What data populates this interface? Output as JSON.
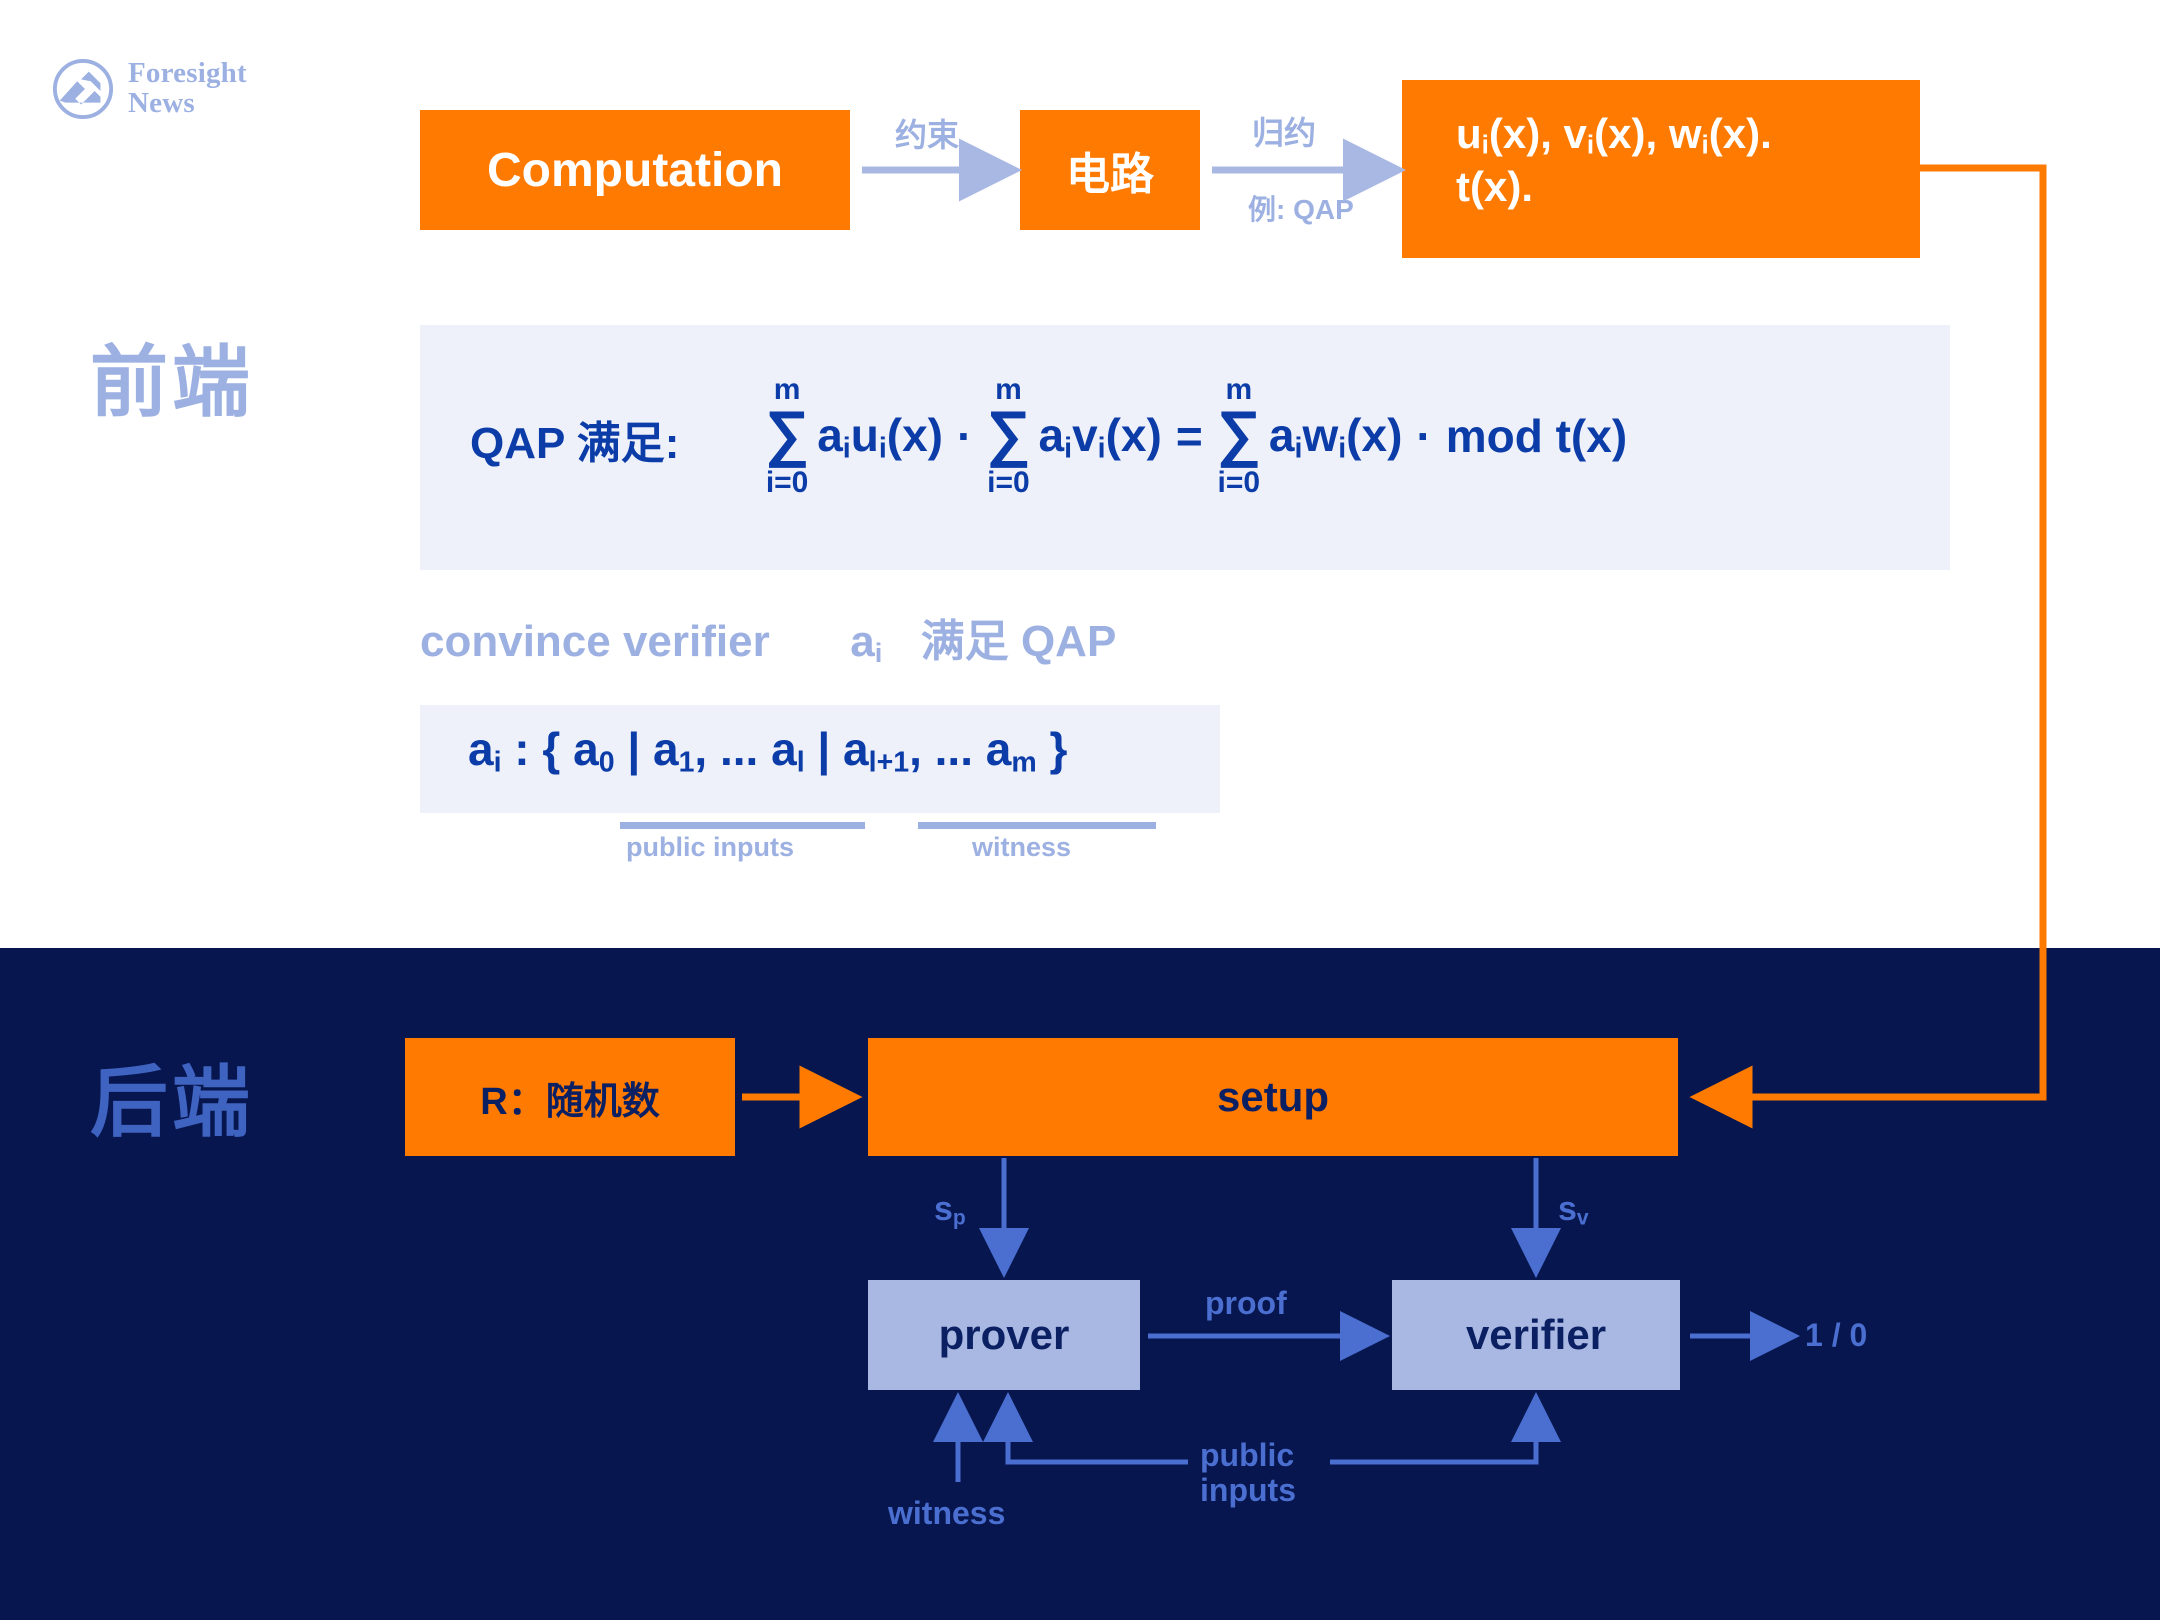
{
  "brand": {
    "line1": "Foresight",
    "line2": "News",
    "logo_icon": "foresight-mountain-logo",
    "color": "#9cb0e2"
  },
  "sections": {
    "frontend_label": "前端",
    "backend_label": "后端",
    "frontend_bg": "#ffffff",
    "backend_bg": "#07164f"
  },
  "colors": {
    "orange": "#ff7a00",
    "navy": "#07164f",
    "deep_blue_text": "#0b3ca8",
    "periwinkle": "#9cb0e2",
    "periwinkle_box": "#a9b8e2",
    "lavender_panel": "#eef1fa",
    "mid_blue": "#4a6fd0"
  },
  "frontend": {
    "boxes": {
      "computation": "Computation",
      "circuit": "电路",
      "polys_line1": "u(x), v(x), w(x).",
      "polys_line2": "t(x).",
      "polys_full": "uᵢ(x), vᵢ(x), wᵢ(x). t(x)."
    },
    "arrow_labels": {
      "constraint": "约束",
      "reduction": "归约",
      "reduction_example": "例: QAP"
    },
    "formula": {
      "label": "QAP 满足:",
      "sum_upper": "m",
      "sum_lower": "i=0",
      "sigma": "∑",
      "term1": "a",
      "term1_sub": "i",
      "term1_fn": "u",
      "term1_fn_sub": "i",
      "term1_arg": "(x)",
      "term2_fn": "v",
      "term3_fn": "w",
      "dot": "·",
      "equals": "=",
      "mod": "mod t(x)",
      "plain": "QAP 满足: Σ(i=0..m) aᵢuᵢ(x) · Σ(i=0..m) aᵢvᵢ(x) = Σ(i=0..m) aᵢwᵢ(x) · mod t(x)"
    },
    "convince_line_1": "convince verifier",
    "convince_line_2": "aᵢ 满足 QAP",
    "convince_a": "a",
    "convince_a_sub": "i",
    "convince_tail": "满足 QAP",
    "ai_set": {
      "plain": "aᵢ : { a₀ | a₁, ... a_l | a_{l+1}, ... a_m }",
      "lhs": "a",
      "lhs_sub": "i",
      "colon_open": " : {",
      "a0": "a",
      "a0_sub": "0",
      "bar": "|",
      "a1": "a",
      "a1_sub": "1",
      "ellipsis": ", ...",
      "al": "a",
      "al_sub": "l",
      "al1": "a",
      "al1_sub": "l+1",
      "am": "a",
      "am_sub": "m",
      "close": "}",
      "underline_label_1": "public inputs",
      "underline_label_2": "witness"
    }
  },
  "backend": {
    "random_box": "R：随机数",
    "setup_box": "setup",
    "prover_box": "prover",
    "verifier_box": "verifier",
    "labels": {
      "s_p": "s",
      "s_p_sub": "p",
      "s_v": "s",
      "s_v_sub": "v",
      "proof": "proof",
      "output": "1 / 0",
      "witness": "witness",
      "public_inputs_line1": "public",
      "public_inputs_line2": "inputs"
    }
  }
}
